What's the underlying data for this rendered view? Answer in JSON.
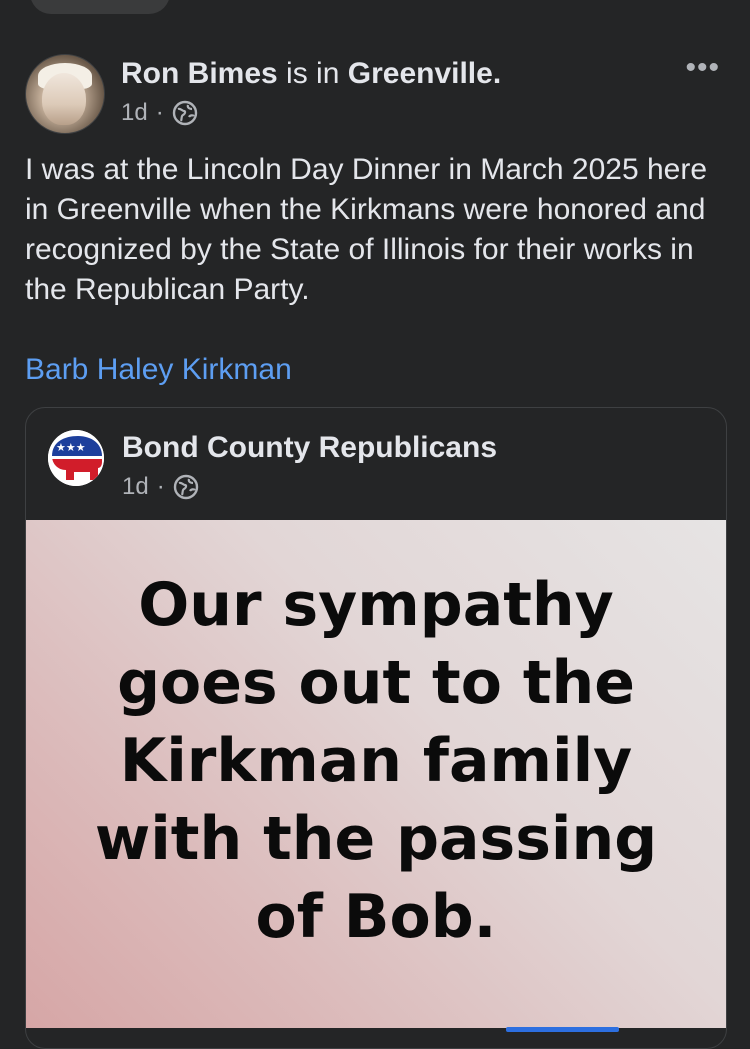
{
  "post": {
    "author": "Ron Bimes",
    "location_connector": "is in",
    "location": "Greenville.",
    "time": "1d",
    "separator": "·",
    "more_label": "•••",
    "text": "I was at the Lincoln Day Dinner in March 2025 here in Greenville when the Kirkmans were honored and recognized by the State of Illinois for their works in the Republican Party.",
    "mention": "Barb Haley Kirkman"
  },
  "shared_post": {
    "page_name": "Bond County Republicans",
    "time": "1d",
    "separator": "·",
    "image_text": "Our sympathy goes out to the Kirkman family with the passing of Bob."
  },
  "colors": {
    "background": "#242526",
    "link": "#5d9ef2",
    "secondary_text": "#b0b3b8",
    "primary_text": "#e4e6eb"
  },
  "icons": {
    "privacy": "globe-icon",
    "menu": "more-options-icon"
  }
}
